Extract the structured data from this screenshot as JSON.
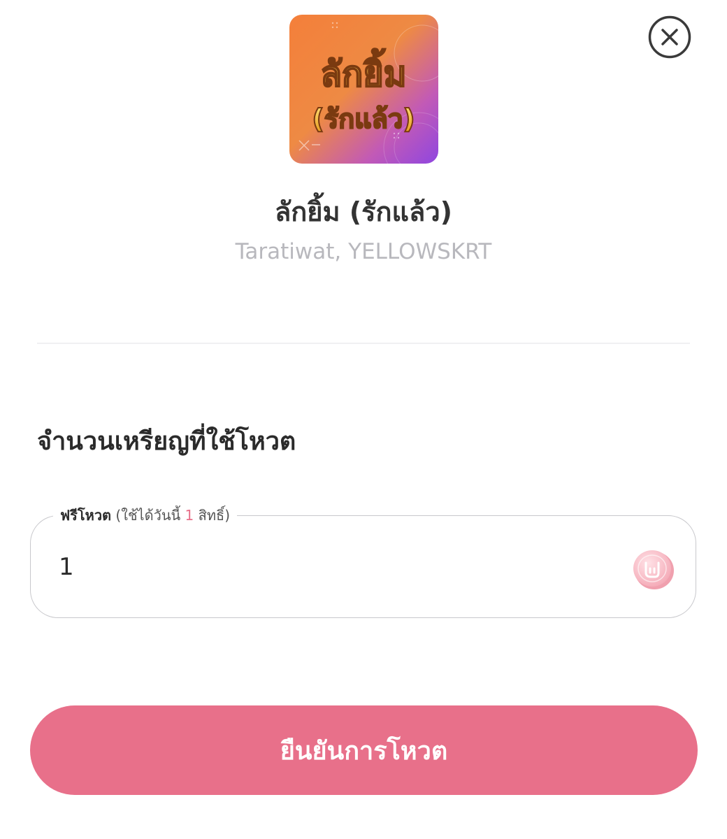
{
  "song": {
    "cover_art_text": "ลักยิ้ม (รักแล้ว)",
    "title": "ลักยิ้ม (รักแล้ว)",
    "artist": "Taratiwat, YELLOWSKRT"
  },
  "close_icon": "close-circle-icon",
  "vote": {
    "section_heading": "จำนวนเหรียญที่ใช้โหวต",
    "legend_label": "ฟรีโหวต",
    "legend_open": "(ใช้ได้วันนี้",
    "legend_count": "1",
    "legend_close": "สิทธิ์)",
    "input_value": "1",
    "coin_icon": "rock-hand-coin-icon"
  },
  "confirm_button": {
    "label": "ยืนยันการโหวต"
  },
  "colors": {
    "accent": "#e8708a",
    "cover_orange": "#f08a3c",
    "cover_purple": "#9a4ce0",
    "muted_text": "#b8b8bd"
  }
}
